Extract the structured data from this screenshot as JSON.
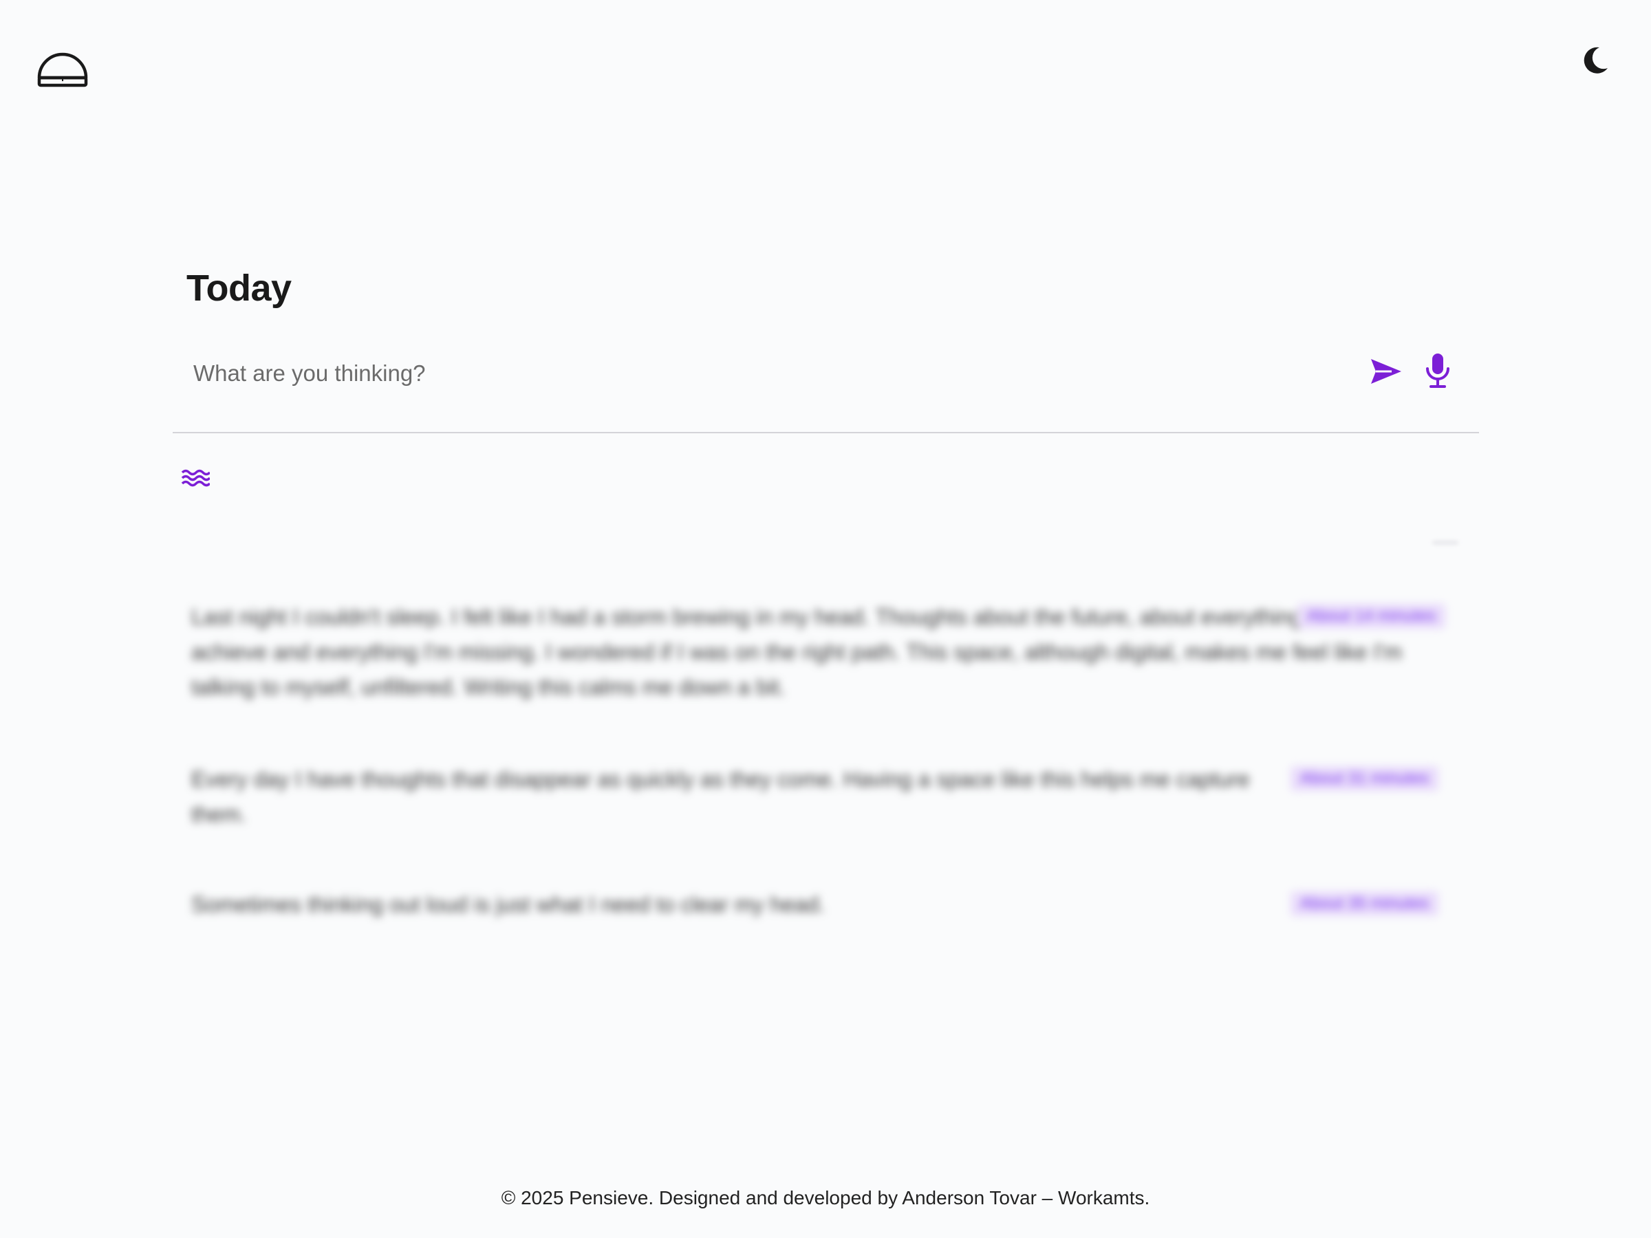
{
  "app": {
    "name": "Pensieve"
  },
  "header": {
    "logo_icon": "pensieve-dome-icon",
    "theme_toggle_icon": "moon-icon"
  },
  "main": {
    "title": "Today",
    "composer": {
      "placeholder": "What are you thinking?",
      "value": "",
      "send_icon": "send-icon",
      "mic_icon": "microphone-icon"
    },
    "filter_icon": "waves-icon",
    "entries": [
      {
        "text": "Last night I couldn't sleep. I felt like I had a storm brewing in my head. Thoughts about the future, about everything I want to achieve and everything I'm missing. I wondered if I was on the right path. This space, although digital, makes me feel like I'm talking to myself, unfiltered. Writing this calms me down a bit.",
        "time": "About 14 minutes"
      },
      {
        "text": "Every day I have thoughts that disappear as quickly as they come. Having a space like this helps me capture them.",
        "time": "About 31 minutes"
      },
      {
        "text": "Sometimes thinking out loud is just what I need to clear my head.",
        "time": "About 35 minutes"
      }
    ]
  },
  "footer": {
    "text": "© 2025 Pensieve. Designed and developed by Anderson Tovar – Workamts."
  },
  "colors": {
    "accent": "#7c1fd6",
    "background": "#fafbfc",
    "text": "#1a1a1a",
    "divider": "#d4d4d8",
    "badge_bg": "#e9dcfb"
  }
}
